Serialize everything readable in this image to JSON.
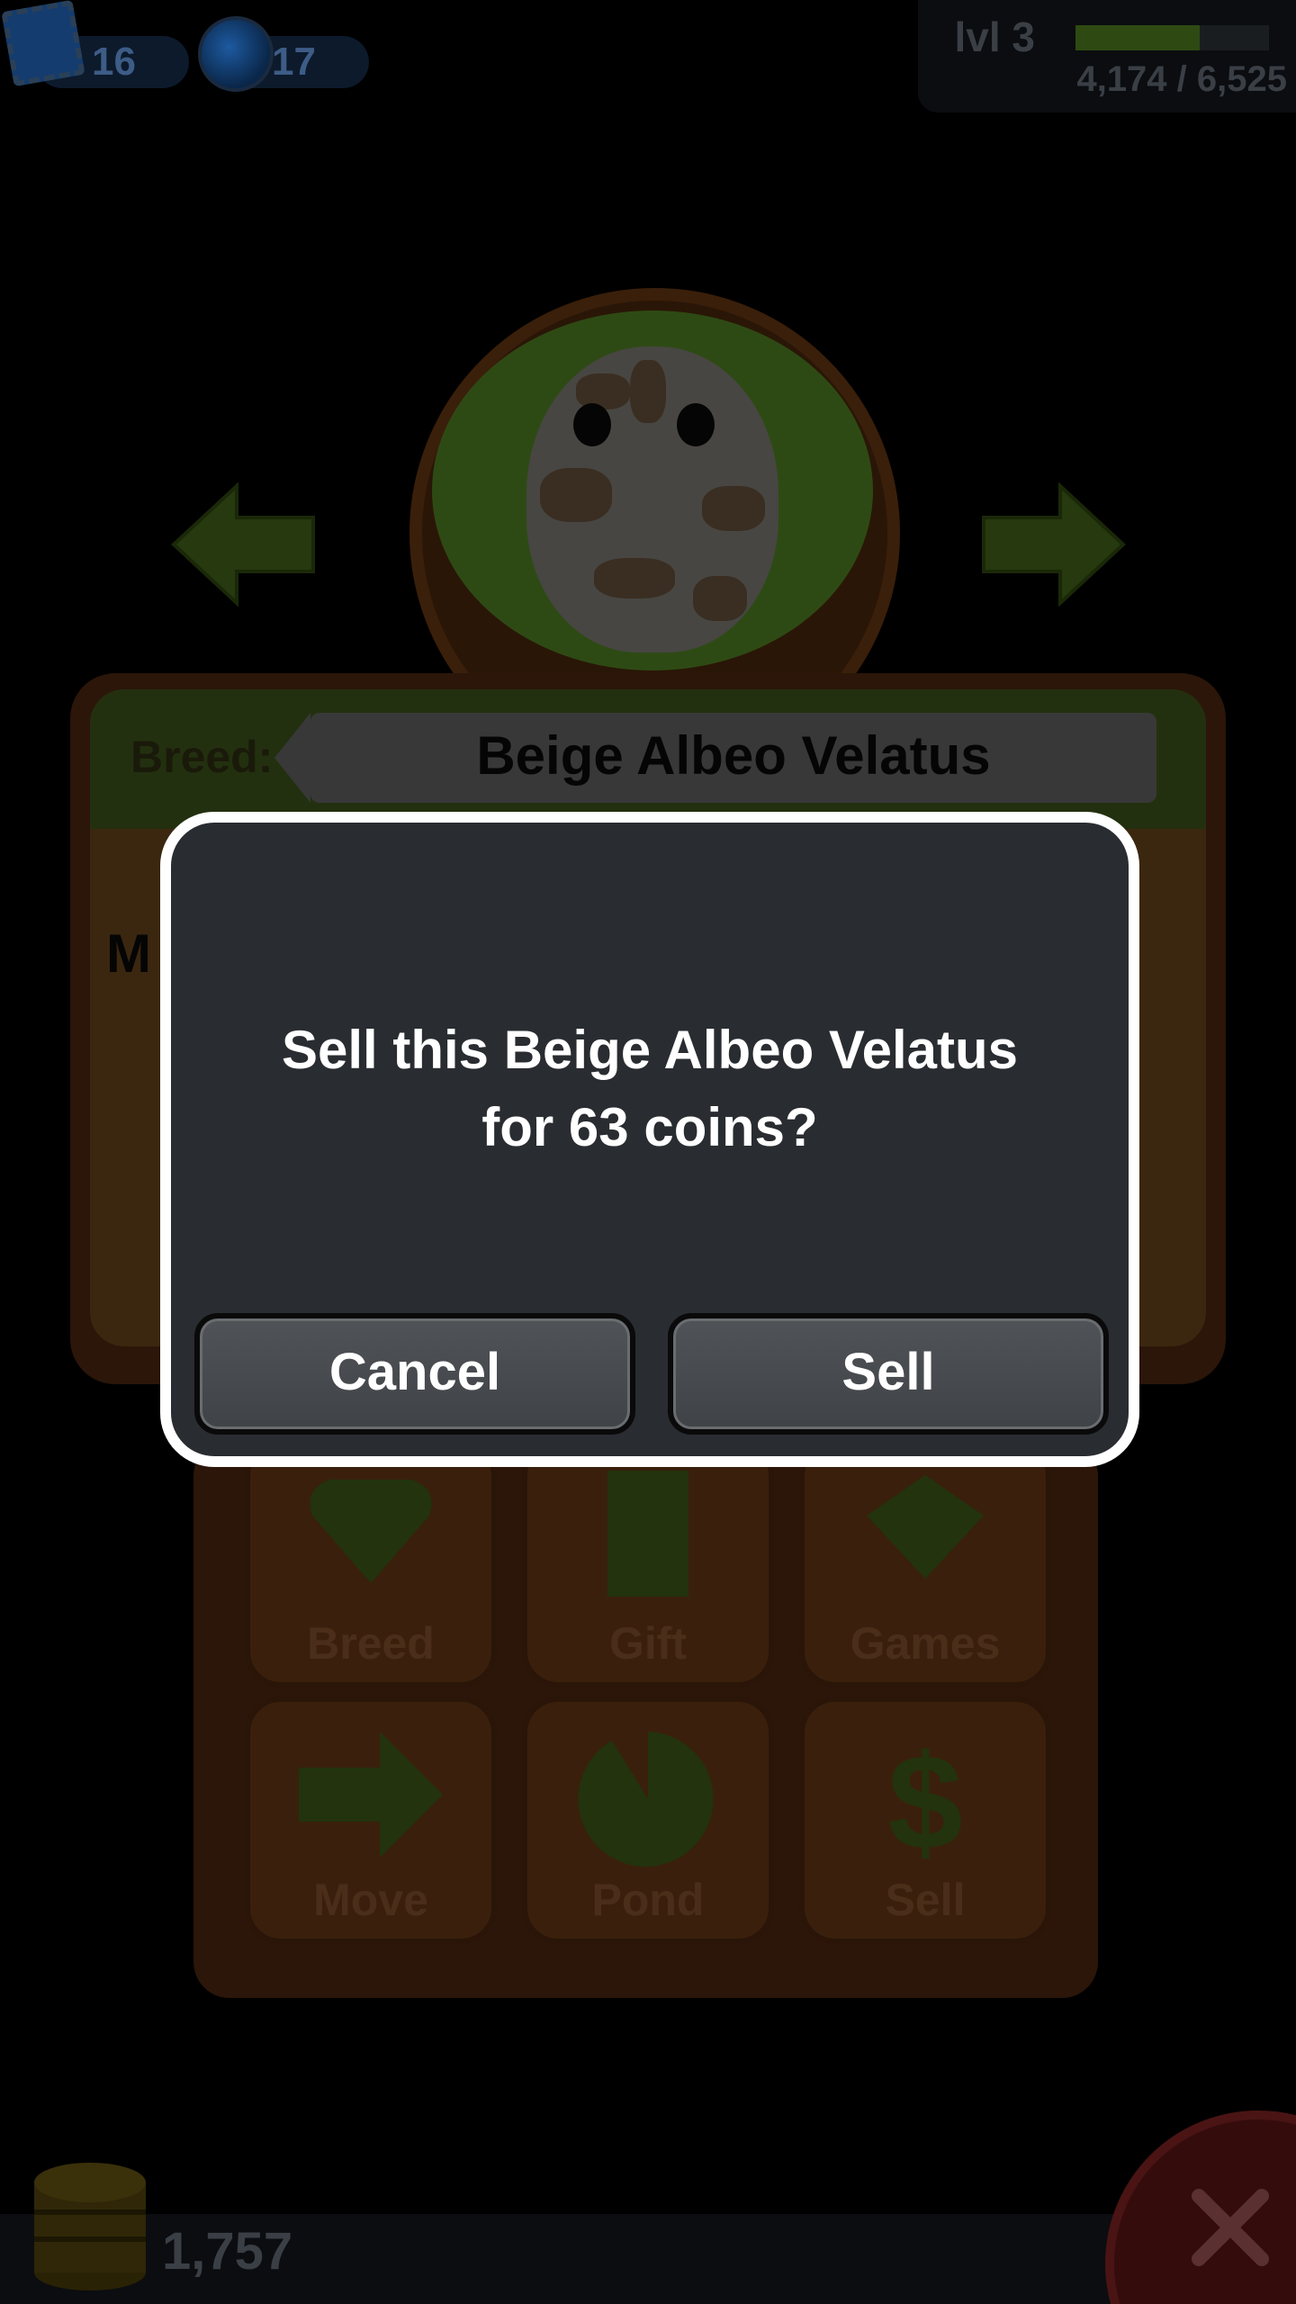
{
  "hud": {
    "stamps": "16",
    "gems": "17",
    "level": "lvl 3",
    "xp_text": "4,174 / 6,525",
    "xp_fraction": 0.64
  },
  "frog_info": {
    "breed_label": "Breed:",
    "breed_name": "Beige Albeo Velatus",
    "partial_text": "M"
  },
  "actions": [
    {
      "label": "Breed",
      "icon": "heart-icon"
    },
    {
      "label": "Gift",
      "icon": "gift-icon"
    },
    {
      "label": "Games",
      "icon": "spinning-top-icon"
    },
    {
      "label": "Move",
      "icon": "arrow-right-icon"
    },
    {
      "label": "Pond",
      "icon": "lily-pad-icon"
    },
    {
      "label": "Sell",
      "icon": "dollar-icon"
    }
  ],
  "footer": {
    "coins": "1,757"
  },
  "dialog": {
    "line1": "Sell this Beige Albeo Velatus",
    "line2": "for 63 coins?",
    "cancel_label": "Cancel",
    "sell_label": "Sell"
  },
  "colors": {
    "dialog_bg": "#292c30",
    "dialog_border": "#ffffff",
    "overlay": "#000000"
  }
}
